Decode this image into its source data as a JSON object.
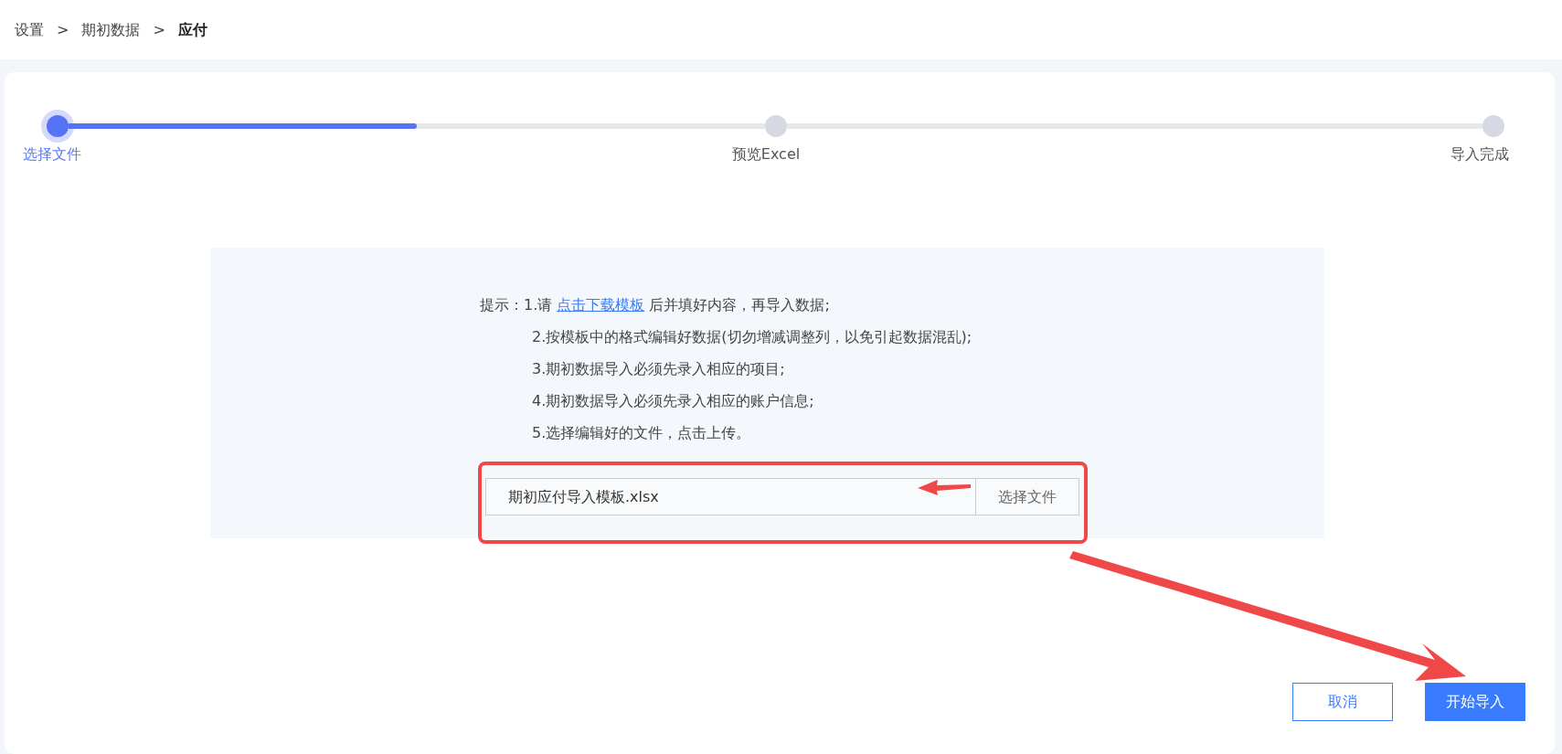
{
  "breadcrumb": [
    {
      "label": "设置",
      "current": false
    },
    {
      "label": "期初数据",
      "current": false
    },
    {
      "label": "应付",
      "current": true
    }
  ],
  "breadcrumb_separator": ">",
  "steps": [
    {
      "label": "选择文件",
      "selected": true
    },
    {
      "label": "预览Excel",
      "selected": false
    },
    {
      "label": "导入完成",
      "selected": false
    }
  ],
  "progress_segments": [
    {
      "level": 0.5
    }
  ],
  "hint": {
    "prefix": "提示：",
    "line_1_before": "1.请",
    "link": "点击下载模板",
    "line_1_after": "后并填好内容，再导入数据;",
    "lines": [
      "2.按模板中的格式编辑好数据(切勿增减调整列，以免引起数据混乱);",
      "3.期初数据导入必须先录入相应的项目;",
      "4.期初数据导入必须先录入相应的账户信息;",
      "5.选择编辑好的文件，点击上传。"
    ]
  },
  "file_field": {
    "value": "期初应付导入模板.xlsx",
    "button": "选择文件"
  },
  "buttons": [
    {
      "label": "取消",
      "kind": "outline"
    },
    {
      "label": "开始导入",
      "kind": "primary"
    }
  ]
}
